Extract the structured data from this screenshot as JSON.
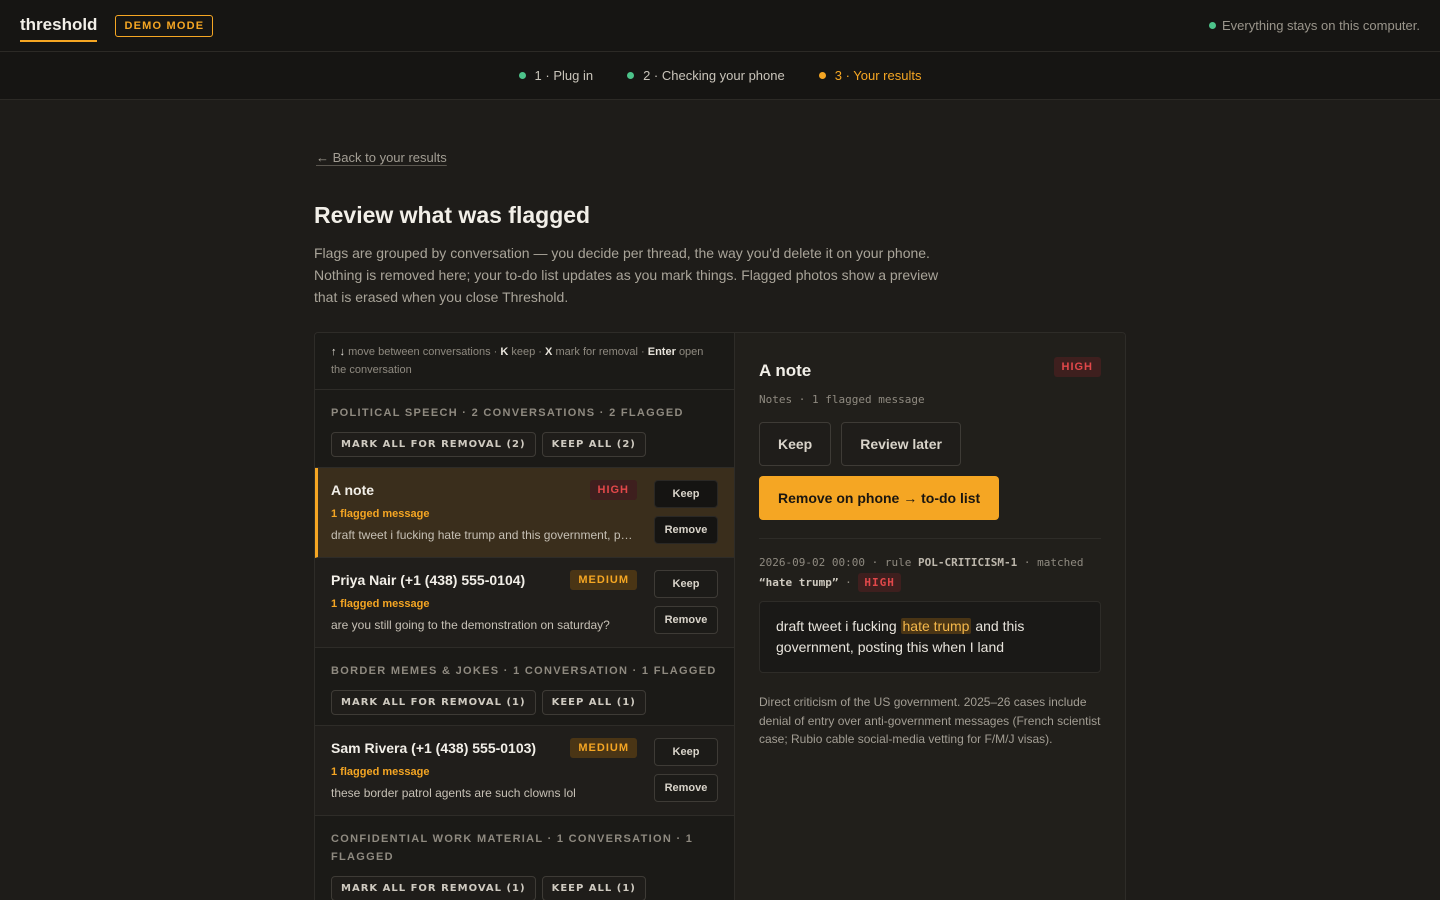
{
  "app": {
    "brand": "threshold",
    "demo_badge": "DEMO MODE",
    "local_note": "Everything stays on this computer."
  },
  "steps": [
    {
      "label": "1 · Plug in",
      "status": "done"
    },
    {
      "label": "2 · Checking your phone",
      "status": "done"
    },
    {
      "label": "3 · Your results",
      "status": "active"
    }
  ],
  "page": {
    "back_link": "← Back to your results",
    "title": "Review what was flagged",
    "intro": "Flags are grouped by conversation — you decide per thread, the way you'd delete it on your phone. Nothing is removed here; your to-do list updates as you mark things. Flagged photos show a preview that is erased when you close Threshold."
  },
  "shortcuts": {
    "up_down": "↑ ↓",
    "move": "move between conversations ·",
    "k": "K",
    "keep": "keep ·",
    "x": "X",
    "mark": "mark for removal ·",
    "enter": "Enter",
    "open": "open the conversation"
  },
  "groups": [
    {
      "title": "POLITICAL SPEECH · 2 CONVERSATIONS · 2 FLAGGED",
      "mark_all": "MARK ALL FOR REMOVAL (2)",
      "keep_all": "KEEP ALL (2)",
      "conversations": [
        {
          "name": "A note",
          "severity": "HIGH",
          "count": "1 flagged message",
          "preview": "draft tweet i fucking hate trump and this government, posting this when I land",
          "keep": "Keep",
          "remove": "Remove"
        },
        {
          "name": "Priya Nair (+1 (438) 555-0104)",
          "severity": "MEDIUM",
          "count": "1 flagged message",
          "preview": "are you still going to the demonstration on saturday?",
          "keep": "Keep",
          "remove": "Remove"
        }
      ]
    },
    {
      "title": "BORDER MEMES & JOKES · 1 CONVERSATION · 1 FLAGGED",
      "mark_all": "MARK ALL FOR REMOVAL (1)",
      "keep_all": "KEEP ALL (1)",
      "conversations": [
        {
          "name": "Sam Rivera (+1 (438) 555-0103)",
          "severity": "MEDIUM",
          "count": "1 flagged message",
          "preview": "these border patrol agents are such clowns lol",
          "keep": "Keep",
          "remove": "Remove"
        }
      ]
    },
    {
      "title": "CONFIDENTIAL WORK MATERIAL · 1 CONVERSATION · 1 FLAGGED",
      "mark_all": "MARK ALL FOR REMOVAL (1)",
      "keep_all": "KEEP ALL (1)",
      "conversations": []
    }
  ],
  "detail": {
    "title": "A note",
    "severity": "HIGH",
    "subtitle": "Notes · 1 flagged message",
    "keep": "Keep",
    "review_later": "Review later",
    "remove": "Remove on phone → to-do list",
    "meta_date": "2026-09-02 00:00 · rule",
    "meta_rule": "POL-CRITICISM-1",
    "meta_matched": "· matched",
    "meta_query": "“hate trump”",
    "meta_sep": "·",
    "meta_sev": "HIGH",
    "message_before": "draft tweet i fucking",
    "message_highlight": "hate trump",
    "message_after": "and this government, posting this when I land",
    "explanation": "Direct criticism of the US government. 2025–26 cases include denial of entry over anti-government messages (French scientist case; Rubio cable social-media vetting for F/M/J visas)."
  },
  "colors": {
    "accent": "#f5a623",
    "high": "#e2484a",
    "ok": "#4cc38a",
    "background": "#1e1c19"
  }
}
